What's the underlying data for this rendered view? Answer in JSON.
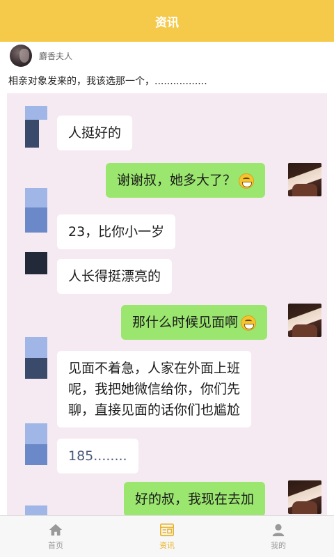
{
  "header": {
    "title": "资讯"
  },
  "post": {
    "author_name": "麝香夫人",
    "text": "相亲对象发来的，我该选那一个，................."
  },
  "chat": {
    "messages": [
      {
        "side": "in",
        "text": "人挺好的"
      },
      {
        "side": "out",
        "text": "谢谢叔，她多大了？",
        "emoji": "grin-emoji"
      },
      {
        "side": "in",
        "text": "23，比你小一岁"
      },
      {
        "side": "in",
        "text": "人长得挺漂亮的"
      },
      {
        "side": "out",
        "text": "那什么时候见面啊",
        "emoji": "grin-emoji"
      },
      {
        "side": "in",
        "lines": [
          "见面不着急，人家在外面上班",
          "呢，我把她微信给你，你们先",
          "聊，直接见面的话你们也尴尬"
        ]
      },
      {
        "side": "in",
        "text": "185........"
      },
      {
        "side": "out",
        "text": "好的叔，我现在去加"
      }
    ]
  },
  "tabbar": {
    "items": [
      {
        "label": "首页",
        "icon": "home-icon",
        "active": false
      },
      {
        "label": "资讯",
        "icon": "news-icon",
        "active": true
      },
      {
        "label": "我的",
        "icon": "user-icon",
        "active": false
      }
    ],
    "active_color": "#e8b32a",
    "inactive_color": "#999999"
  },
  "colors": {
    "header_bg": "#f5c94a",
    "bubble_out": "#9ae66e",
    "chat_bg": "#f6eaf2"
  }
}
